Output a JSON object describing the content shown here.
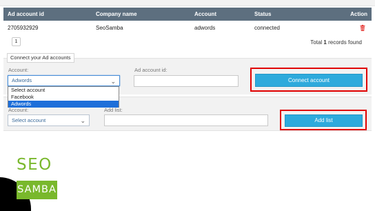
{
  "table": {
    "headers": [
      "Ad account id",
      "Company name",
      "Account",
      "Status",
      "Action"
    ],
    "rows": [
      {
        "ad_account_id": "2705932929",
        "company_name": "SeoSamba",
        "account": "adwords",
        "status": "connected"
      }
    ]
  },
  "pagination": {
    "page": "1",
    "total_prefix": "Total ",
    "total_count": "1",
    "total_suffix": " records found"
  },
  "connect_section": {
    "tab_label": "Connect your Ad accounts",
    "account_label": "Account:",
    "account_value": "Adwords",
    "ad_account_label": "Ad account id:",
    "ad_account_value": "",
    "button_label": "Connect account",
    "dropdown_options": [
      "Select account",
      "Facebook",
      "Adwords"
    ],
    "dropdown_selected": "Adwords"
  },
  "list_section": {
    "account_label": "Account:",
    "account_value": "Select account",
    "add_list_label": "Add list:",
    "add_list_value": "",
    "button_label": "Add list"
  },
  "logo": {
    "line1": "SEO",
    "line2": "SAMBA"
  },
  "colors": {
    "header_bg": "#5d6f7f",
    "button": "#2eaadc",
    "highlight": "#e00000",
    "brand_green": "#79b82c",
    "delete_icon": "#e53935"
  },
  "icons": {
    "delete": "trash-icon",
    "dropdown": "chevron-down-icon"
  }
}
